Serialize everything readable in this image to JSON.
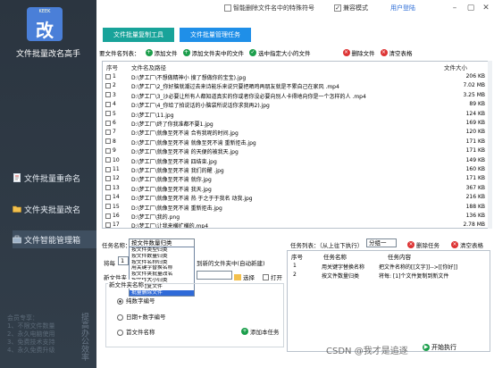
{
  "sidebar": {
    "logo_text": "KEEK",
    "logo_char": "改",
    "app_title": "文件批量改名高手",
    "items": [
      {
        "label": "文件批量重命名",
        "icon": "document-icon"
      },
      {
        "label": "文件夹批量改名",
        "icon": "folder-icon"
      },
      {
        "label": "文件智能管理箱",
        "icon": "toolbox-icon"
      }
    ],
    "promo_lines": [
      "会员专享：",
      "1、不限文件数量",
      "2、永久电脑使用",
      "3、免费技术支持",
      "4、永久免费升级"
    ],
    "promo_vertical": "提高办公效率"
  },
  "titlebar": {
    "option1_label": "智能删除文件名中的特殊符号",
    "option2_label": "兼容模式",
    "login_label": "用户登陆"
  },
  "tabs": [
    {
      "label": "文件批量复制工具"
    },
    {
      "label": "文件批量管理任务"
    }
  ],
  "toolbar": {
    "file_list_label": "要文件名列表：",
    "add_file": "添加文件",
    "add_folder": "添加文件夹中的文件",
    "select_size": "选中指定大小的文件",
    "delete_file": "删除文件",
    "clear_table": "清空表格"
  },
  "table": {
    "headers": {
      "index": "序号",
      "path": "文件名及路径",
      "size": "文件大小"
    },
    "rows": [
      {
        "index": "1",
        "path": "D:\\梦工厂\\不想做精神小 搜了想做你的宝宝).jpg",
        "size": "206 KB"
      },
      {
        "index": "2",
        "path": "D:\\梦工厂\\2_你好脑就潮过去来诗能乐来说只要把晒鸡再朋友就是不累自己在家风 .mp4",
        "size": "7.02 MB"
      },
      {
        "index": "3",
        "path": "D:\\梦工厂\\3_沙必要让所有人都知道真实的你或者你没必要向别人卡得地向你是一个怎样的人 .mp4",
        "size": "3.25 MB"
      },
      {
        "index": "4",
        "path": "D:\\梦工厂\\4_你给了拍说话的小脑袋所说话你求我再2).jpg",
        "size": "89 KB"
      },
      {
        "index": "5",
        "path": "D:\\梦工厂\\11.jpg",
        "size": "124 KB"
      },
      {
        "index": "6",
        "path": "D:\\梦工厂\\终了你我准都不要1.jpg",
        "size": "169 KB"
      },
      {
        "index": "7",
        "path": "D:\\梦工厂\\就像至死不渝 合有我呢的时间.jpg",
        "size": "120 KB"
      },
      {
        "index": "8",
        "path": "D:\\梦工厂\\就像至死不渝 就像至死不渝 重新拒击.jpg",
        "size": "171 KB"
      },
      {
        "index": "9",
        "path": "D:\\梦工厂\\就像至死不渝 的天便的被我天.jpg",
        "size": "171 KB"
      },
      {
        "index": "10",
        "path": "D:\\梦工厂\\就像至死不渝 四结束.jpg",
        "size": "149 KB"
      },
      {
        "index": "11",
        "path": "D:\\梦工厂\\就像至死不渝 我们的醒 .jpg",
        "size": "160 KB"
      },
      {
        "index": "12",
        "path": "D:\\梦工厂\\就像至死不渝 就你.jpg",
        "size": "171 KB"
      },
      {
        "index": "13",
        "path": "D:\\梦工厂\\就像至死不渝 我天.jpg",
        "size": "367 KB"
      },
      {
        "index": "14",
        "path": "D:\\梦工厂\\就像至死不渝 热 于之于于我名 动我.jpg",
        "size": "216 KB"
      },
      {
        "index": "15",
        "path": "D:\\梦工厂\\就像至死不渝 重新拒击.jpg",
        "size": "188 KB"
      },
      {
        "index": "16",
        "path": "D:\\梦工厂\\我的.png",
        "size": "136 KB"
      },
      {
        "index": "17",
        "path": "D:\\梦工厂\\让我来横扩横的.mp4",
        "size": "2.78 MB"
      },
      {
        "index": "18",
        "path": "D:\\梦工厂\\如原谁还是怎能的你还不些出来你的想 .mp4",
        "size": "2.79 MB"
      }
    ]
  },
  "task_form": {
    "task_name_label": "任务名称：",
    "task_type_value": "按文件数量归类",
    "type_options": [
      "按文件类型归类",
      "按文件数量归类",
      "按文件名称归类",
      "用关键字替换名称",
      "按文件夹批量改名",
      "按文件大小归类",
      "删除重复文件",
      "批量删除文件"
    ],
    "selected_option_index": 7,
    "per_label": "将每",
    "per_value": "1",
    "target_label": "到新的文件夹中(自动新建)",
    "new_folder_label": "新文件夹",
    "select_label": "选择",
    "open_label": "打开",
    "naming_label": "新文件夹名称",
    "radio_options": [
      "纯数字编号",
      "日期+数字编号",
      "首文件名称"
    ],
    "radio_selected": 0,
    "add_task_label": "添加本任务"
  },
  "task_panel": {
    "list_label": "任务列表：（从上往下执行）",
    "group_value": "分组一",
    "delete_task": "删除任务",
    "clear_table": "清空表格",
    "headers": {
      "index": "序号",
      "name": "任务名称",
      "content": "任务内容"
    },
    "rows": [
      {
        "index": "1",
        "name": "用关键字替换名称",
        "content": "把文件名称的[[文字]]-->[[你好]]"
      },
      {
        "index": "2",
        "name": "按文件数量归类",
        "content": "将每: [1]个文件复制到新文件"
      }
    ],
    "run_label": "开始执行"
  },
  "watermark": "CSDN @我才是追逐"
}
